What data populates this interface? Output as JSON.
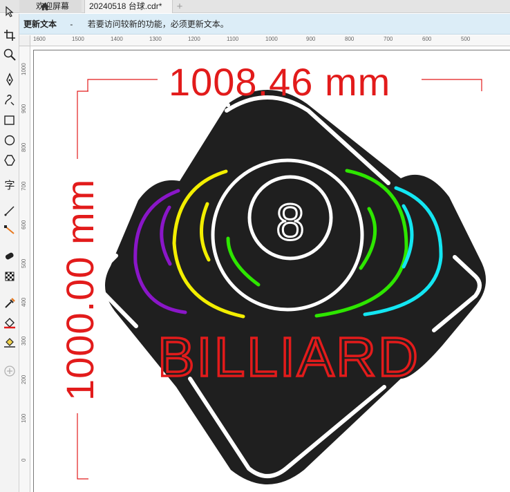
{
  "tabs": [
    {
      "label": "欢迎屏幕",
      "icon": "home-icon"
    },
    {
      "label": "20240518 台球.cdr*"
    },
    {
      "label": "+"
    }
  ],
  "notice": {
    "title": "更新文本",
    "separator": "-",
    "message": "若要访问较新的功能，必须更新文本。"
  },
  "toolbox": [
    "pick-tool-icon",
    "crop-tool-icon",
    "zoom-tool-icon",
    "pen-tool-icon",
    "freehand-tool-icon",
    "rectangle-tool-icon",
    "ellipse-tool-icon",
    "polygon-tool-icon",
    "text-tool-icon",
    "line-tool-icon",
    "connector-tool-icon",
    "shadow-tool-icon",
    "transparency-tool-icon",
    "eyedropper-tool-icon",
    "fill-tool-icon",
    "smart-fill-tool-icon",
    "add-tool-icon"
  ],
  "text_tool_glyph": "字",
  "ruler_h": [
    "1600",
    "1500",
    "1400",
    "1300",
    "1200",
    "1100",
    "1000",
    "900",
    "800",
    "700",
    "600",
    "500"
  ],
  "ruler_v": [
    "1000",
    "900",
    "800",
    "700",
    "600",
    "500",
    "400",
    "300",
    "200",
    "100",
    "0"
  ],
  "dimensions": {
    "width": "1008.46 mm",
    "height": "1000.00 mm"
  },
  "design": {
    "ball_number": "8",
    "wordmark": "BILLIARD",
    "colors": {
      "background": "#1f1f1f",
      "outline": "#ffffff",
      "purple": "#8a16c8",
      "yellow": "#f2ee00",
      "green": "#2ee600",
      "cyan": "#13e6f2",
      "red": "#e21b1b"
    }
  }
}
